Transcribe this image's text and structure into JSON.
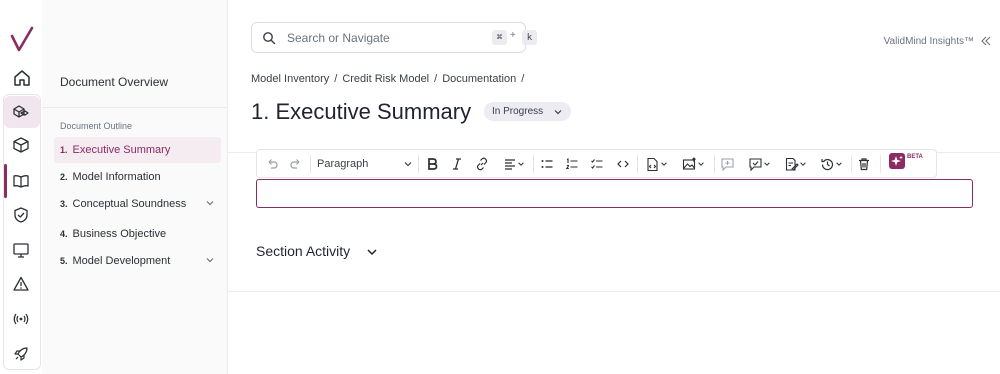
{
  "app": {
    "brand_label": "ValidMind Insights™",
    "accent_color": "#8a2b63"
  },
  "rail": {
    "icons": [
      "validmind-logo",
      "home-icon",
      "model-inventory-icon",
      "cube-icon",
      "book-icon",
      "shield-check-icon",
      "monitor-icon",
      "warning-icon",
      "broadcast-icon",
      "rocket-icon"
    ],
    "active": "book-icon"
  },
  "sidebar": {
    "overview_label": "Document Overview",
    "outline_label": "Document Outline",
    "items": [
      {
        "num": "1.",
        "label": "Executive Summary",
        "active": true,
        "expandable": false
      },
      {
        "num": "2.",
        "label": "Model Information",
        "active": false,
        "expandable": false
      },
      {
        "num": "3.",
        "label": "Conceptual Soundness",
        "active": false,
        "expandable": true
      },
      {
        "num": "4.",
        "label": "Business Objective",
        "active": false,
        "expandable": false
      },
      {
        "num": "5.",
        "label": "Model Development",
        "active": false,
        "expandable": true
      }
    ]
  },
  "search": {
    "placeholder": "Search or Navigate",
    "shortcut_key1": "⌘",
    "shortcut_plus": "+",
    "shortcut_key2": "k"
  },
  "breadcrumb": {
    "items": [
      "Model Inventory",
      "Credit Risk Model",
      "Documentation"
    ],
    "separator": "/"
  },
  "page": {
    "title": "1. Executive Summary",
    "status": "In Progress"
  },
  "toolbar": {
    "block_type": "Paragraph",
    "beta_label": "BETA",
    "buttons": [
      "undo",
      "redo",
      "paragraph-select",
      "bold",
      "italic",
      "link",
      "align",
      "bulleted-list",
      "numbered-list",
      "todo-list",
      "code",
      "source-edit",
      "image",
      "comment",
      "comments-archive",
      "track-changes",
      "history",
      "delete",
      "ai-assistant"
    ]
  },
  "editor": {
    "content": ""
  },
  "activity": {
    "label": "Section Activity"
  }
}
